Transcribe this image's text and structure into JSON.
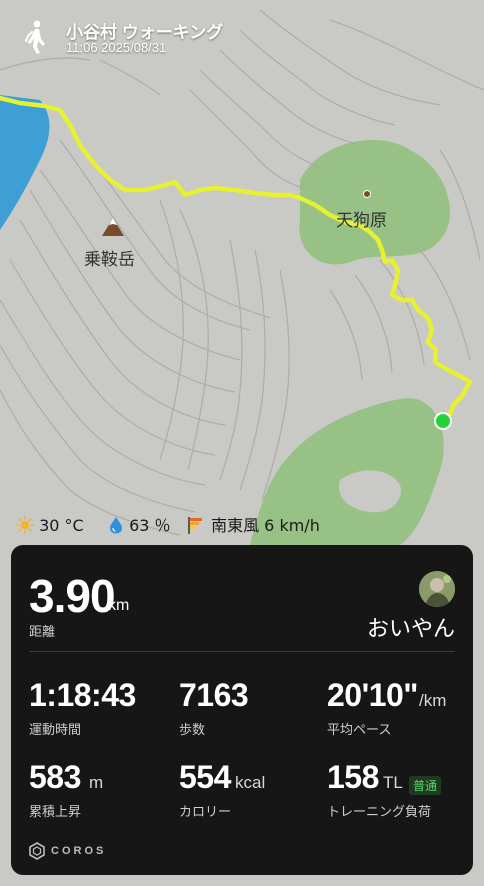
{
  "app": {
    "title": "小谷村 ウォーキング",
    "datetime": "11:06 2025/08/31"
  },
  "map": {
    "places": [
      {
        "name": "乗鞍岳",
        "icon": "mountain-peak-icon"
      },
      {
        "name": "天狗原",
        "icon": "waypoint-dot-icon"
      }
    ],
    "route_color": "#e6f230",
    "end_marker_color": "#22d43a"
  },
  "weather": {
    "temperature": "30 °C",
    "humidity": "63 ％",
    "wind": "南東風 6 km/h"
  },
  "summary": {
    "distance": "3.90",
    "distance_unit": "km",
    "distance_label": "距離",
    "username": "おいやん"
  },
  "stats": [
    {
      "value": "1:18:43",
      "unit": "",
      "label": "運動時間"
    },
    {
      "value": "7163",
      "unit": "",
      "label": "歩数"
    },
    {
      "value": "20'10\"",
      "unit": "/km",
      "label": "平均ペース"
    },
    {
      "value": "583",
      "unit": "m",
      "label": "累積上昇"
    },
    {
      "value": "554",
      "unit": "kcal",
      "label": "カロリー"
    },
    {
      "value": "158",
      "unit": "TL",
      "label": "トレーニング負荷",
      "badge": "普通"
    }
  ],
  "brand": {
    "name": "COROS"
  },
  "colors": {
    "card_bg": "#161616",
    "badge_green": "#5fd36a"
  }
}
